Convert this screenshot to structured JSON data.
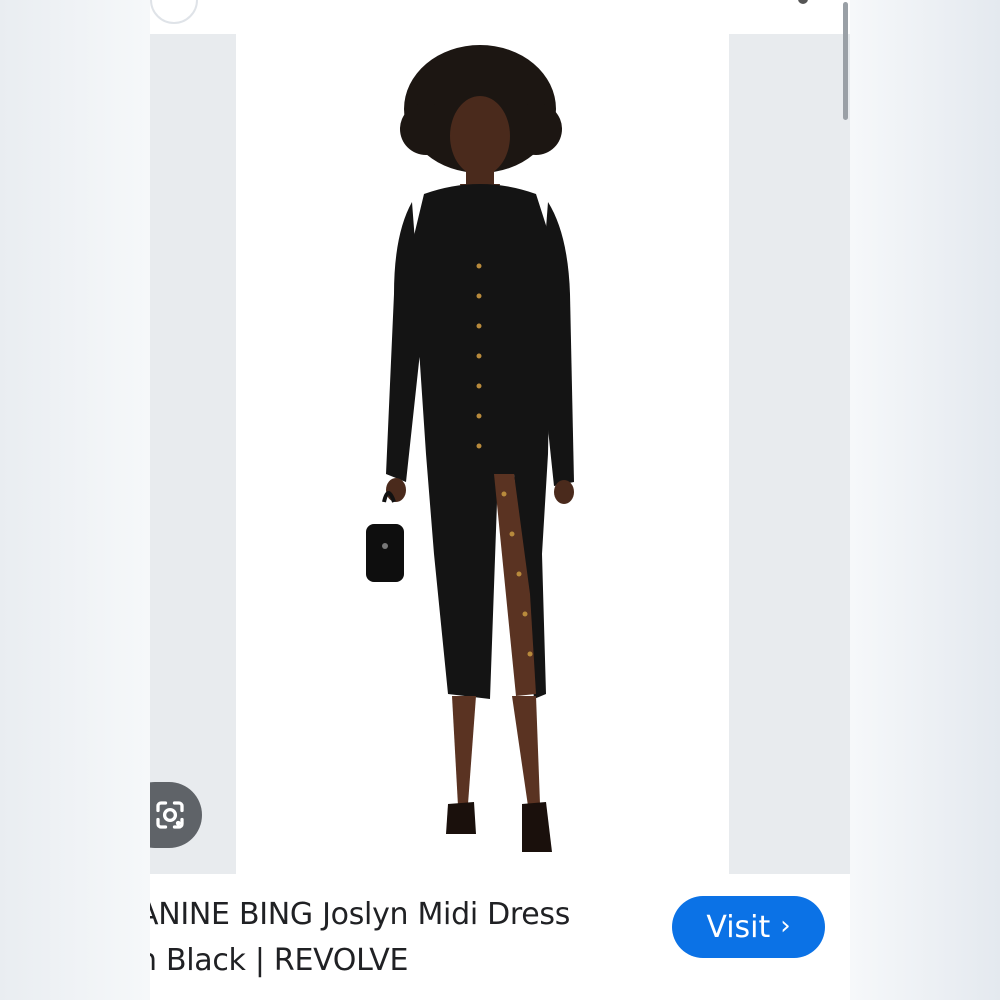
{
  "result": {
    "title_line1": "ANINE BING Joslyn Midi Dress",
    "title_line2": "n Black | REVOLVE",
    "visit_label": "Visit",
    "visit_chevron": "›"
  },
  "icons": {
    "lens": "lens-icon",
    "chevron": "chevron-right-icon"
  },
  "colors": {
    "accent": "#0b72e6",
    "lens_button": "#5f6368",
    "panel_bg": "#e8ebee",
    "dress": "#141414"
  }
}
